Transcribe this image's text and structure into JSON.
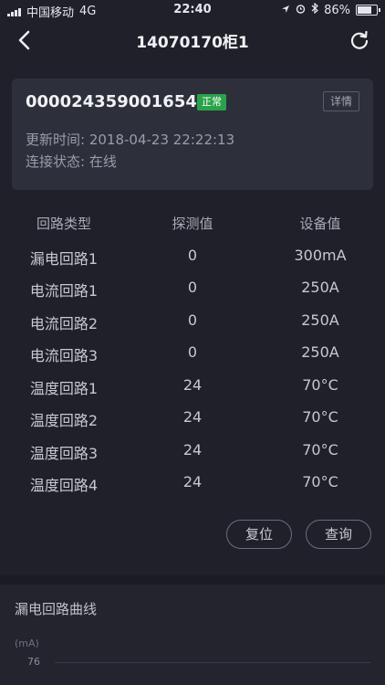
{
  "status_bar": {
    "carrier": "中国移动",
    "network": "4G",
    "time": "22:40",
    "battery": "86%",
    "battery_level": 0.86
  },
  "nav": {
    "title": "14070170柜1",
    "back_icon": "chevron-left-icon",
    "refresh_icon": "refresh-icon"
  },
  "device": {
    "id": "000024359001654",
    "status": "正常",
    "status_color": "#2aa24a",
    "detail_label": "详情",
    "update_time": "更新时间: 2018-04-23 22:22:13",
    "connection": "连接状态: 在线"
  },
  "table": {
    "headers": [
      "回路类型",
      "探测值",
      "设备值"
    ],
    "rows": [
      [
        "漏电回路1",
        "0",
        "300mA"
      ],
      [
        "电流回路1",
        "0",
        "250A"
      ],
      [
        "电流回路2",
        "0",
        "250A"
      ],
      [
        "电流回路3",
        "0",
        "250A"
      ],
      [
        "温度回路1",
        "24",
        "70°C"
      ],
      [
        "温度回路2",
        "24",
        "70°C"
      ],
      [
        "温度回路3",
        "24",
        "70°C"
      ],
      [
        "温度回路4",
        "24",
        "70°C"
      ]
    ]
  },
  "actions": {
    "reset_label": "复位",
    "query_label": "查询"
  },
  "chart": {
    "title": "漏电回路曲线",
    "unit": "(mA)",
    "tick": "76"
  }
}
